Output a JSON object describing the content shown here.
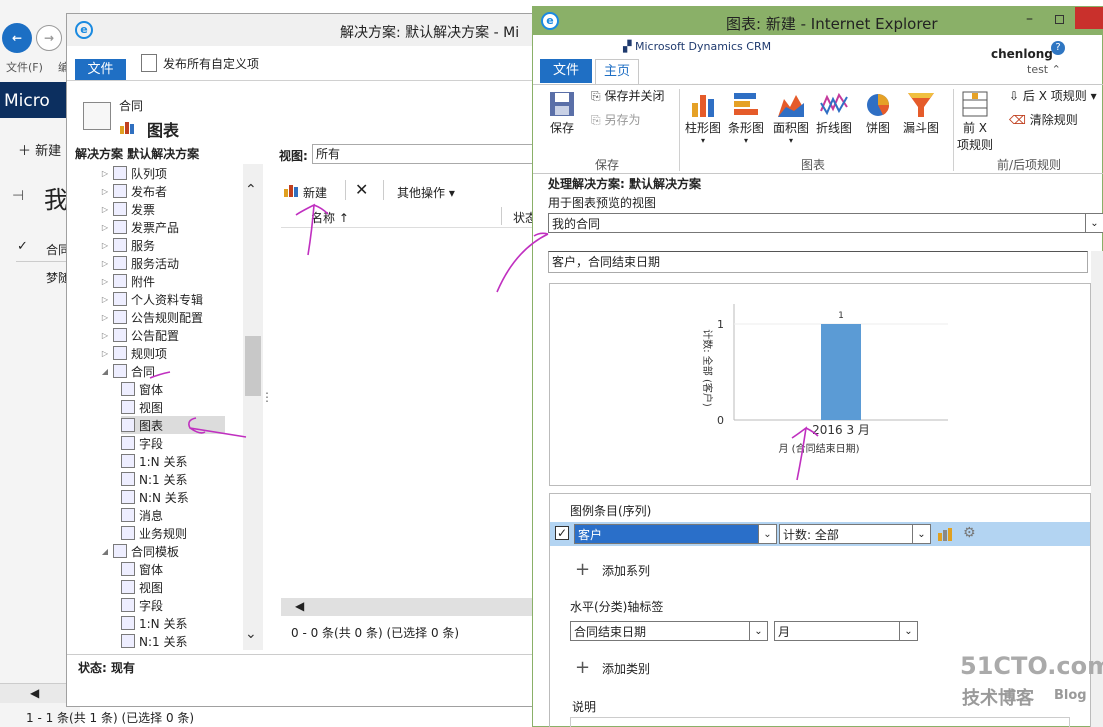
{
  "bg": {
    "menu_file": "文件(F)",
    "menu_edit": "编",
    "brand": "Micro",
    "new_label": "新建",
    "heading": "我",
    "col_header": "合同",
    "row1": "梦随",
    "status": "1 - 1 条(共 1 条) (已选择 0 条)"
  },
  "sol": {
    "title": "解决方案: 默认解决方案 - Mi",
    "tab_file": "文件",
    "publish_label": "发布所有自定义项",
    "entity_name": "合同",
    "component": "图表",
    "solution_label": "解决方案 默认解决方案",
    "view_label": "视图:",
    "view_value": "所有",
    "new_btn": "新建",
    "more_actions": "其他操作",
    "col_name": "名称 ↑",
    "col_status": "状态",
    "paging": "0 - 0 条(共 0 条) (已选择 0 条)",
    "status_bar": "状态: 现有",
    "tree": [
      {
        "label": "队列项",
        "level": 1,
        "arrow": "▷"
      },
      {
        "label": "发布者",
        "level": 1,
        "arrow": "▷"
      },
      {
        "label": "发票",
        "level": 1,
        "arrow": "▷"
      },
      {
        "label": "发票产品",
        "level": 1,
        "arrow": "▷"
      },
      {
        "label": "服务",
        "level": 1,
        "arrow": "▷"
      },
      {
        "label": "服务活动",
        "level": 1,
        "arrow": "▷"
      },
      {
        "label": "附件",
        "level": 1,
        "arrow": "▷"
      },
      {
        "label": "个人资料专辑",
        "level": 1,
        "arrow": "▷"
      },
      {
        "label": "公告规则配置",
        "level": 1,
        "arrow": "▷"
      },
      {
        "label": "公告配置",
        "level": 1,
        "arrow": "▷"
      },
      {
        "label": "规则项",
        "level": 1,
        "arrow": "▷"
      },
      {
        "label": "合同",
        "level": 1,
        "arrow": "◢"
      },
      {
        "label": "窗体",
        "level": 2,
        "arrow": ""
      },
      {
        "label": "视图",
        "level": 2,
        "arrow": ""
      },
      {
        "label": "图表",
        "level": 2,
        "arrow": "",
        "selected": true
      },
      {
        "label": "字段",
        "level": 2,
        "arrow": ""
      },
      {
        "label": "1:N 关系",
        "level": 2,
        "arrow": ""
      },
      {
        "label": "N:1 关系",
        "level": 2,
        "arrow": ""
      },
      {
        "label": "N:N 关系",
        "level": 2,
        "arrow": ""
      },
      {
        "label": "消息",
        "level": 2,
        "arrow": ""
      },
      {
        "label": "业务规则",
        "level": 2,
        "arrow": ""
      },
      {
        "label": "合同模板",
        "level": 1,
        "arrow": "◢"
      },
      {
        "label": "窗体",
        "level": 2,
        "arrow": ""
      },
      {
        "label": "视图",
        "level": 2,
        "arrow": ""
      },
      {
        "label": "字段",
        "level": 2,
        "arrow": ""
      },
      {
        "label": "1:N 关系",
        "level": 2,
        "arrow": ""
      },
      {
        "label": "N:1 关系",
        "level": 2,
        "arrow": ""
      }
    ]
  },
  "ie": {
    "title": "图表: 新建 - Internet Explorer",
    "crm_brand": "Microsoft Dynamics CRM",
    "user": "chenlong",
    "org": "test",
    "tab_file": "文件",
    "tab_home": "主页",
    "save_close": "保存并关闭",
    "save_as": "另存为",
    "save": "保存",
    "group_save": "保存",
    "chart_types": [
      "柱形图",
      "条形图",
      "面积图",
      "折线图",
      "饼图",
      "漏斗图"
    ],
    "group_charts": "图表",
    "topx_label1": "前 X",
    "topx_label2": "项规则",
    "bottomx": "后 X 项规则",
    "clear_rules": "清除规则",
    "group_rules": "前/后项规则",
    "solution_line": "处理解决方案: 默认解决方案",
    "view_prompt": "用于图表预览的视图",
    "view_value": "我的合同",
    "chart_name": "客户，合同结束日期",
    "legend_label": "图例条目(序列)",
    "series_field": "客户",
    "series_agg": "计数: 全部",
    "add_series": "添加系列",
    "category_label": "水平(分类)轴标签",
    "category_field": "合同结束日期",
    "category_group": "月",
    "add_category": "添加类别",
    "description_label": "说明"
  },
  "watermark": {
    "line1": "51CTO.com",
    "line2": "技术博客",
    "line3": "Blog"
  },
  "chart_data": {
    "type": "bar",
    "categories": [
      "2016 3 月"
    ],
    "values": [
      1
    ],
    "data_labels": [
      "1"
    ],
    "xlabel": "月 (合同结束日期)",
    "ylabel": "计数: 全部 (客户)",
    "yticks": [
      "0",
      "1"
    ],
    "ylim": [
      0,
      1
    ],
    "color": "#5b9bd5"
  }
}
